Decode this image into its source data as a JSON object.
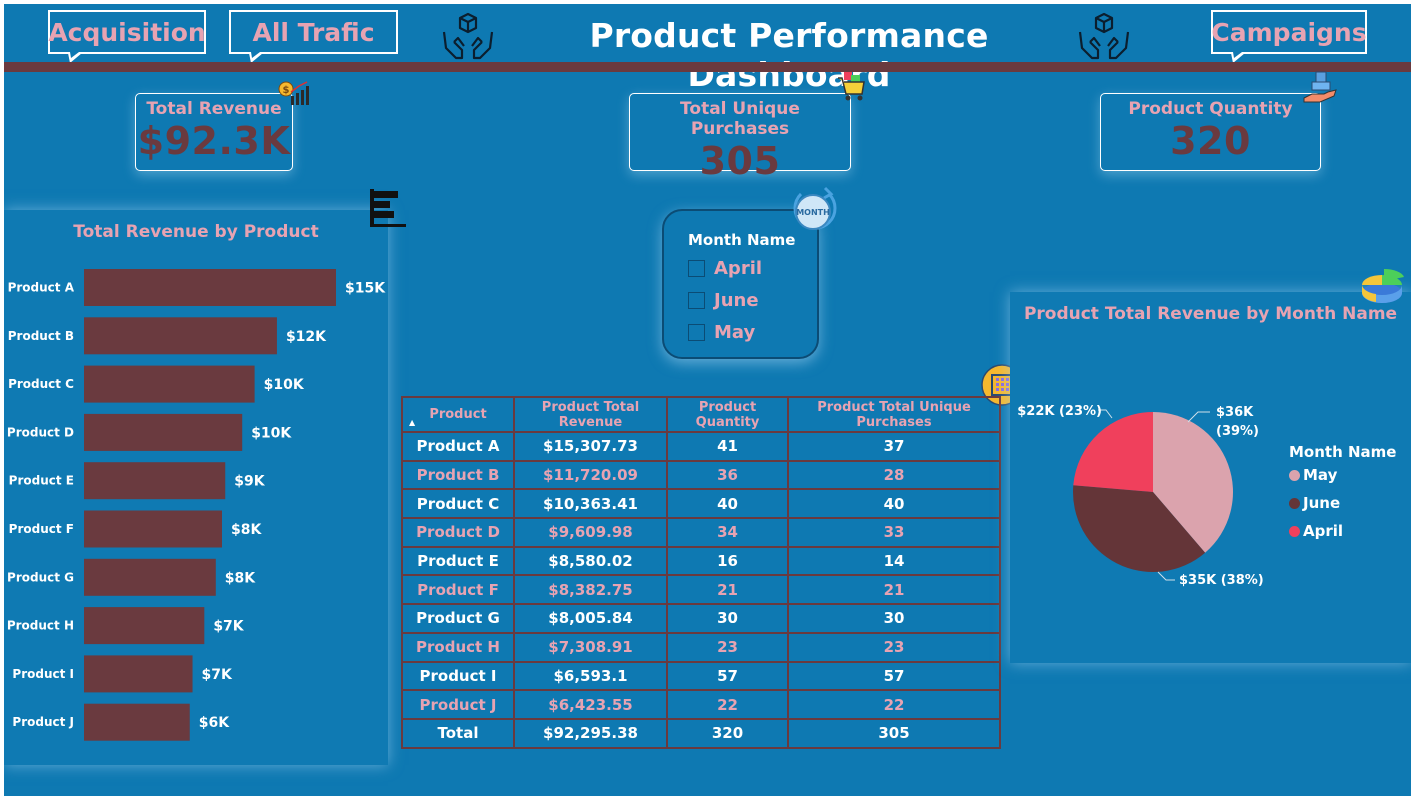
{
  "header": {
    "title": "Product Performance Dashboard",
    "nav": [
      {
        "label": "Acquisition"
      },
      {
        "label": "All Trafic"
      },
      {
        "label": "Campaigns"
      }
    ]
  },
  "kpis": [
    {
      "label": "Total Revenue",
      "value": "$92.3K",
      "icon": "revenue-chart-icon"
    },
    {
      "label": "Total Unique Purchases",
      "value": "305",
      "icon": "shopping-cart-icon"
    },
    {
      "label": "Product Quantity",
      "value": "320",
      "icon": "hand-box-icon"
    }
  ],
  "colors": {
    "background": "#0e79b2",
    "accent_pink": "#e7a3b2",
    "bar_brown": "#6a3a3f",
    "pie_may": "#dba3ad",
    "pie_june": "#643538",
    "pie_april": "#f0405c"
  },
  "slicer": {
    "title": "Month Name",
    "badge": "MONTH",
    "options": [
      "April",
      "June",
      "May"
    ]
  },
  "table": {
    "columns": [
      "Product",
      "Product Total Revenue",
      "Product Quantity",
      "Product Total Unique Purchases"
    ],
    "rows": [
      [
        "Product A",
        "$15,307.73",
        "41",
        "37"
      ],
      [
        "Product B",
        "$11,720.09",
        "36",
        "28"
      ],
      [
        "Product C",
        "$10,363.41",
        "40",
        "40"
      ],
      [
        "Product D",
        "$9,609.98",
        "34",
        "33"
      ],
      [
        "Product E",
        "$8,580.02",
        "16",
        "14"
      ],
      [
        "Product F",
        "$8,382.75",
        "21",
        "21"
      ],
      [
        "Product G",
        "$8,005.84",
        "30",
        "30"
      ],
      [
        "Product H",
        "$7,308.91",
        "23",
        "23"
      ],
      [
        "Product I",
        "$6,593.1",
        "57",
        "57"
      ],
      [
        "Product J",
        "$6,423.55",
        "22",
        "22"
      ]
    ],
    "total": [
      "Total",
      "$92,295.38",
      "320",
      "305"
    ]
  },
  "chart_data": [
    {
      "type": "bar",
      "orientation": "horizontal",
      "title": "Total Revenue by Product",
      "categories": [
        "Product A",
        "Product B",
        "Product C",
        "Product D",
        "Product E",
        "Product F",
        "Product G",
        "Product H",
        "Product I",
        "Product J"
      ],
      "values": [
        15307.73,
        11720.09,
        10363.41,
        9609.98,
        8580.02,
        8382.75,
        8005.84,
        7308.91,
        6593.1,
        6423.55
      ],
      "data_labels": [
        "$15K",
        "$12K",
        "$10K",
        "$10K",
        "$9K",
        "$8K",
        "$8K",
        "$7K",
        "$7K",
        "$6K"
      ],
      "color": "#6a3a3f",
      "grid": false
    },
    {
      "type": "pie",
      "title": "Product Total Revenue by Month Name",
      "legend_title": "Month Name",
      "legend_position": "right",
      "slices": [
        {
          "name": "May",
          "value": 36,
          "label": "$36K",
          "percent_label": "(39%)",
          "color": "#dba3ad"
        },
        {
          "name": "June",
          "value": 35,
          "label": "$35K (38%)",
          "color": "#643538"
        },
        {
          "name": "April",
          "value": 22,
          "label": "$22K (23%)",
          "color": "#f0405c"
        }
      ]
    }
  ]
}
